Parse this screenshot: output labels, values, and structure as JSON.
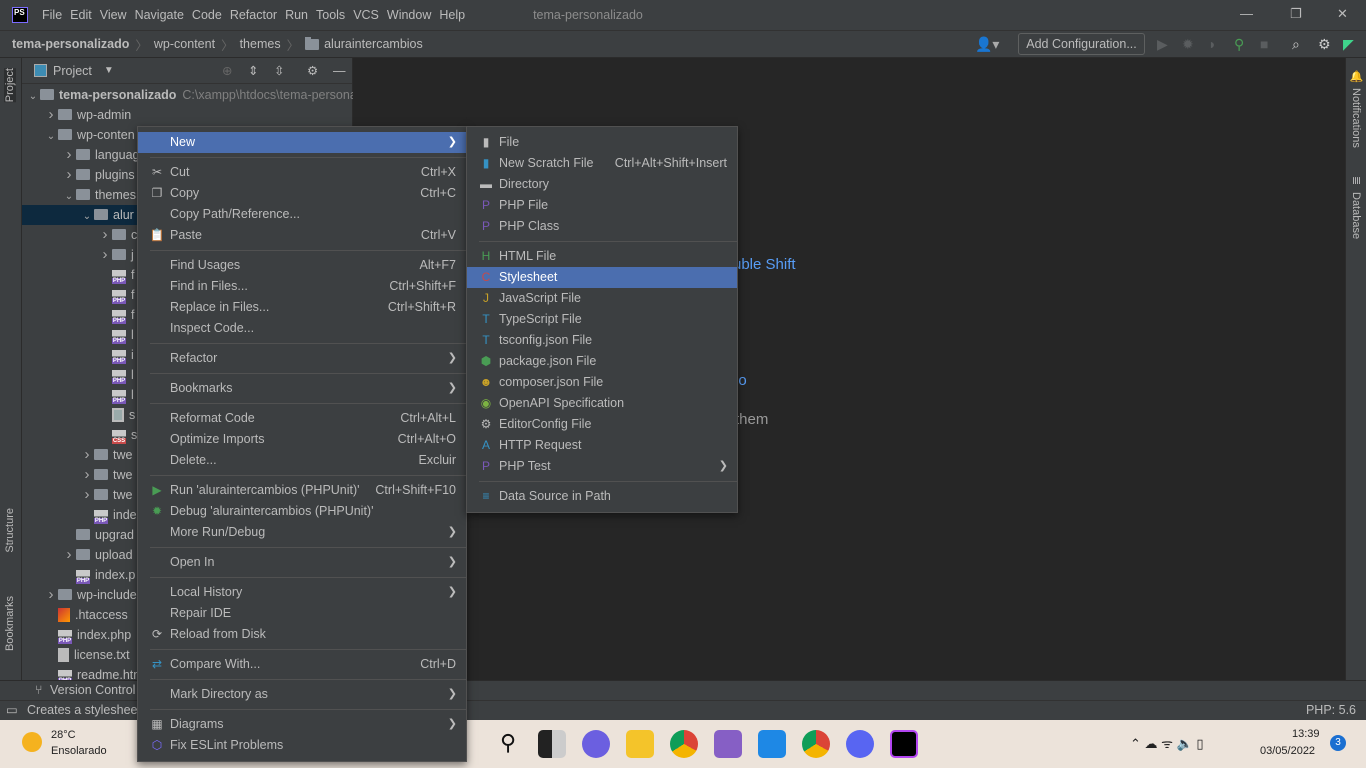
{
  "app": {
    "title": "tema-personalizado",
    "logo": "PS"
  },
  "menubar": [
    "File",
    "Edit",
    "View",
    "Navigate",
    "Code",
    "Refactor",
    "Run",
    "Tools",
    "VCS",
    "Window",
    "Help"
  ],
  "breadcrumb": [
    "tema-personalizado",
    "wp-content",
    "themes",
    "aluraintercambios"
  ],
  "toolbar": {
    "add_configuration": "Add Configuration..."
  },
  "project": {
    "title": "Project",
    "root_path": "C:\\xampp\\htdocs\\tema-persona",
    "rows": [
      {
        "label": "tema-personalizado",
        "level": 0,
        "arrow": "down",
        "icon": "folder",
        "bold": true
      },
      {
        "label": "wp-admin",
        "level": 1,
        "arrow": "right",
        "icon": "folder"
      },
      {
        "label": "wp-conten",
        "level": 1,
        "arrow": "down",
        "icon": "folder"
      },
      {
        "label": "languag",
        "level": 2,
        "arrow": "right",
        "icon": "folder"
      },
      {
        "label": "plugins",
        "level": 2,
        "arrow": "right",
        "icon": "folder"
      },
      {
        "label": "themes",
        "level": 2,
        "arrow": "down",
        "icon": "folder"
      },
      {
        "label": "alur",
        "level": 3,
        "arrow": "down",
        "icon": "folder",
        "selected": true
      },
      {
        "label": "c",
        "level": 4,
        "arrow": "right",
        "icon": "folder"
      },
      {
        "label": "j",
        "level": 4,
        "arrow": "right",
        "icon": "folder"
      },
      {
        "label": "f",
        "level": 4,
        "icon": "php"
      },
      {
        "label": "f",
        "level": 4,
        "icon": "php"
      },
      {
        "label": "f",
        "level": 4,
        "icon": "php"
      },
      {
        "label": "l",
        "level": 4,
        "icon": "php"
      },
      {
        "label": "i",
        "level": 4,
        "icon": "php"
      },
      {
        "label": "l",
        "level": 4,
        "icon": "php"
      },
      {
        "label": "l",
        "level": 4,
        "icon": "php"
      },
      {
        "label": "s",
        "level": 4,
        "icon": "img"
      },
      {
        "label": "s",
        "level": 4,
        "icon": "css"
      },
      {
        "label": "twe",
        "level": 3,
        "arrow": "right",
        "icon": "folder"
      },
      {
        "label": "twe",
        "level": 3,
        "arrow": "right",
        "icon": "folder"
      },
      {
        "label": "twe",
        "level": 3,
        "arrow": "right",
        "icon": "folder"
      },
      {
        "label": "inde",
        "level": 3,
        "icon": "php"
      },
      {
        "label": "upgrad",
        "level": 2,
        "icon": "folder"
      },
      {
        "label": "upload",
        "level": 2,
        "arrow": "right",
        "icon": "folder"
      },
      {
        "label": "index.p",
        "level": 2,
        "icon": "php"
      },
      {
        "label": "wp-include",
        "level": 1,
        "arrow": "right",
        "icon": "folder"
      },
      {
        "label": ".htaccess",
        "level": 1,
        "icon": "ht"
      },
      {
        "label": "index.php",
        "level": 1,
        "icon": "php"
      },
      {
        "label": "license.txt",
        "level": 1,
        "icon": "txt"
      },
      {
        "label": "readme.htm",
        "level": 1,
        "icon": "php"
      }
    ]
  },
  "editor_hints": {
    "shift": "uble Shift",
    "recent": "io",
    "drop": "them"
  },
  "side_tabs": {
    "project": "Project",
    "structure": "Structure",
    "bookmarks": "Bookmarks",
    "notifications": "Notifications",
    "database": "Database"
  },
  "bottom": {
    "version_control": "Version Control",
    "status": "Creates a stylesheet",
    "php_version": "PHP: 5.6"
  },
  "context_menu": [
    {
      "label": "New",
      "submenu": true,
      "highlight": true
    },
    {
      "sep": true
    },
    {
      "label": "Cut",
      "shortcut": "Ctrl+X",
      "icon": "✂"
    },
    {
      "label": "Copy",
      "shortcut": "Ctrl+C",
      "icon": "❐"
    },
    {
      "label": "Copy Path/Reference..."
    },
    {
      "label": "Paste",
      "shortcut": "Ctrl+V",
      "icon": "📋"
    },
    {
      "sep": true
    },
    {
      "label": "Find Usages",
      "shortcut": "Alt+F7"
    },
    {
      "label": "Find in Files...",
      "shortcut": "Ctrl+Shift+F"
    },
    {
      "label": "Replace in Files...",
      "shortcut": "Ctrl+Shift+R"
    },
    {
      "label": "Inspect Code..."
    },
    {
      "sep": true
    },
    {
      "label": "Refactor",
      "submenu": true
    },
    {
      "sep": true
    },
    {
      "label": "Bookmarks",
      "submenu": true
    },
    {
      "sep": true
    },
    {
      "label": "Reformat Code",
      "shortcut": "Ctrl+Alt+L"
    },
    {
      "label": "Optimize Imports",
      "shortcut": "Ctrl+Alt+O"
    },
    {
      "label": "Delete...",
      "shortcut": "Excluir"
    },
    {
      "sep": true
    },
    {
      "label": "Run 'aluraintercambios (PHPUnit)'",
      "shortcut": "Ctrl+Shift+F10",
      "icon": "▶",
      "icon_color": "#499c54"
    },
    {
      "label": "Debug 'aluraintercambios (PHPUnit)'",
      "icon": "✹",
      "icon_color": "#499c54"
    },
    {
      "label": "More Run/Debug",
      "submenu": true
    },
    {
      "sep": true
    },
    {
      "label": "Open In",
      "submenu": true
    },
    {
      "sep": true
    },
    {
      "label": "Local History",
      "submenu": true
    },
    {
      "label": "Repair IDE"
    },
    {
      "label": "Reload from Disk",
      "icon": "⟳"
    },
    {
      "sep": true
    },
    {
      "label": "Compare With...",
      "shortcut": "Ctrl+D",
      "icon": "⇄",
      "icon_color": "#3592c4"
    },
    {
      "sep": true
    },
    {
      "label": "Mark Directory as",
      "submenu": true
    },
    {
      "sep": true
    },
    {
      "label": "Diagrams",
      "submenu": true,
      "icon": "▦"
    },
    {
      "label": "Fix ESLint Problems",
      "icon": "⬡",
      "icon_color": "#7b6cff"
    }
  ],
  "new_submenu": [
    {
      "label": "File",
      "icon": "▮"
    },
    {
      "label": "New Scratch File",
      "shortcut": "Ctrl+Alt+Shift+Insert",
      "icon": "▮",
      "icon_color": "#3592c4"
    },
    {
      "label": "Directory",
      "icon": "▬"
    },
    {
      "label": "PHP File",
      "icon": "P",
      "icon_color": "#7a58b8"
    },
    {
      "label": "PHP Class",
      "icon": "P",
      "icon_color": "#7a58b8"
    },
    {
      "sep": true
    },
    {
      "label": "HTML File",
      "icon": "H",
      "icon_color": "#499c54"
    },
    {
      "label": "Stylesheet",
      "icon": "C",
      "icon_color": "#c74a4a",
      "highlight": true
    },
    {
      "label": "JavaScript File",
      "icon": "J",
      "icon_color": "#c9a227"
    },
    {
      "label": "TypeScript File",
      "icon": "T",
      "icon_color": "#3592c4"
    },
    {
      "label": "tsconfig.json File",
      "icon": "T",
      "icon_color": "#3592c4"
    },
    {
      "label": "package.json File",
      "icon": "⬢",
      "icon_color": "#499c54"
    },
    {
      "label": "composer.json File",
      "icon": "☻",
      "icon_color": "#c9a227"
    },
    {
      "label": "OpenAPI Specification",
      "icon": "◉",
      "icon_color": "#7cb342"
    },
    {
      "label": "EditorConfig File",
      "icon": "⚙"
    },
    {
      "label": "HTTP Request",
      "icon": "A",
      "icon_color": "#3592c4"
    },
    {
      "label": "PHP Test",
      "submenu": true,
      "icon": "P",
      "icon_color": "#7a58b8"
    },
    {
      "sep": true
    },
    {
      "label": "Data Source in Path",
      "icon": "≡",
      "icon_color": "#3592c4"
    }
  ],
  "taskbar": {
    "weather_temp": "28°C",
    "weather_desc": "Ensolarado",
    "time": "13:39",
    "date": "03/05/2022",
    "notif_count": "3"
  },
  "colors": {
    "highlight": "#4b6eaf",
    "selection": "#0d293e",
    "link": "#589df6",
    "panel": "#3c3f41",
    "editor": "#262626"
  }
}
